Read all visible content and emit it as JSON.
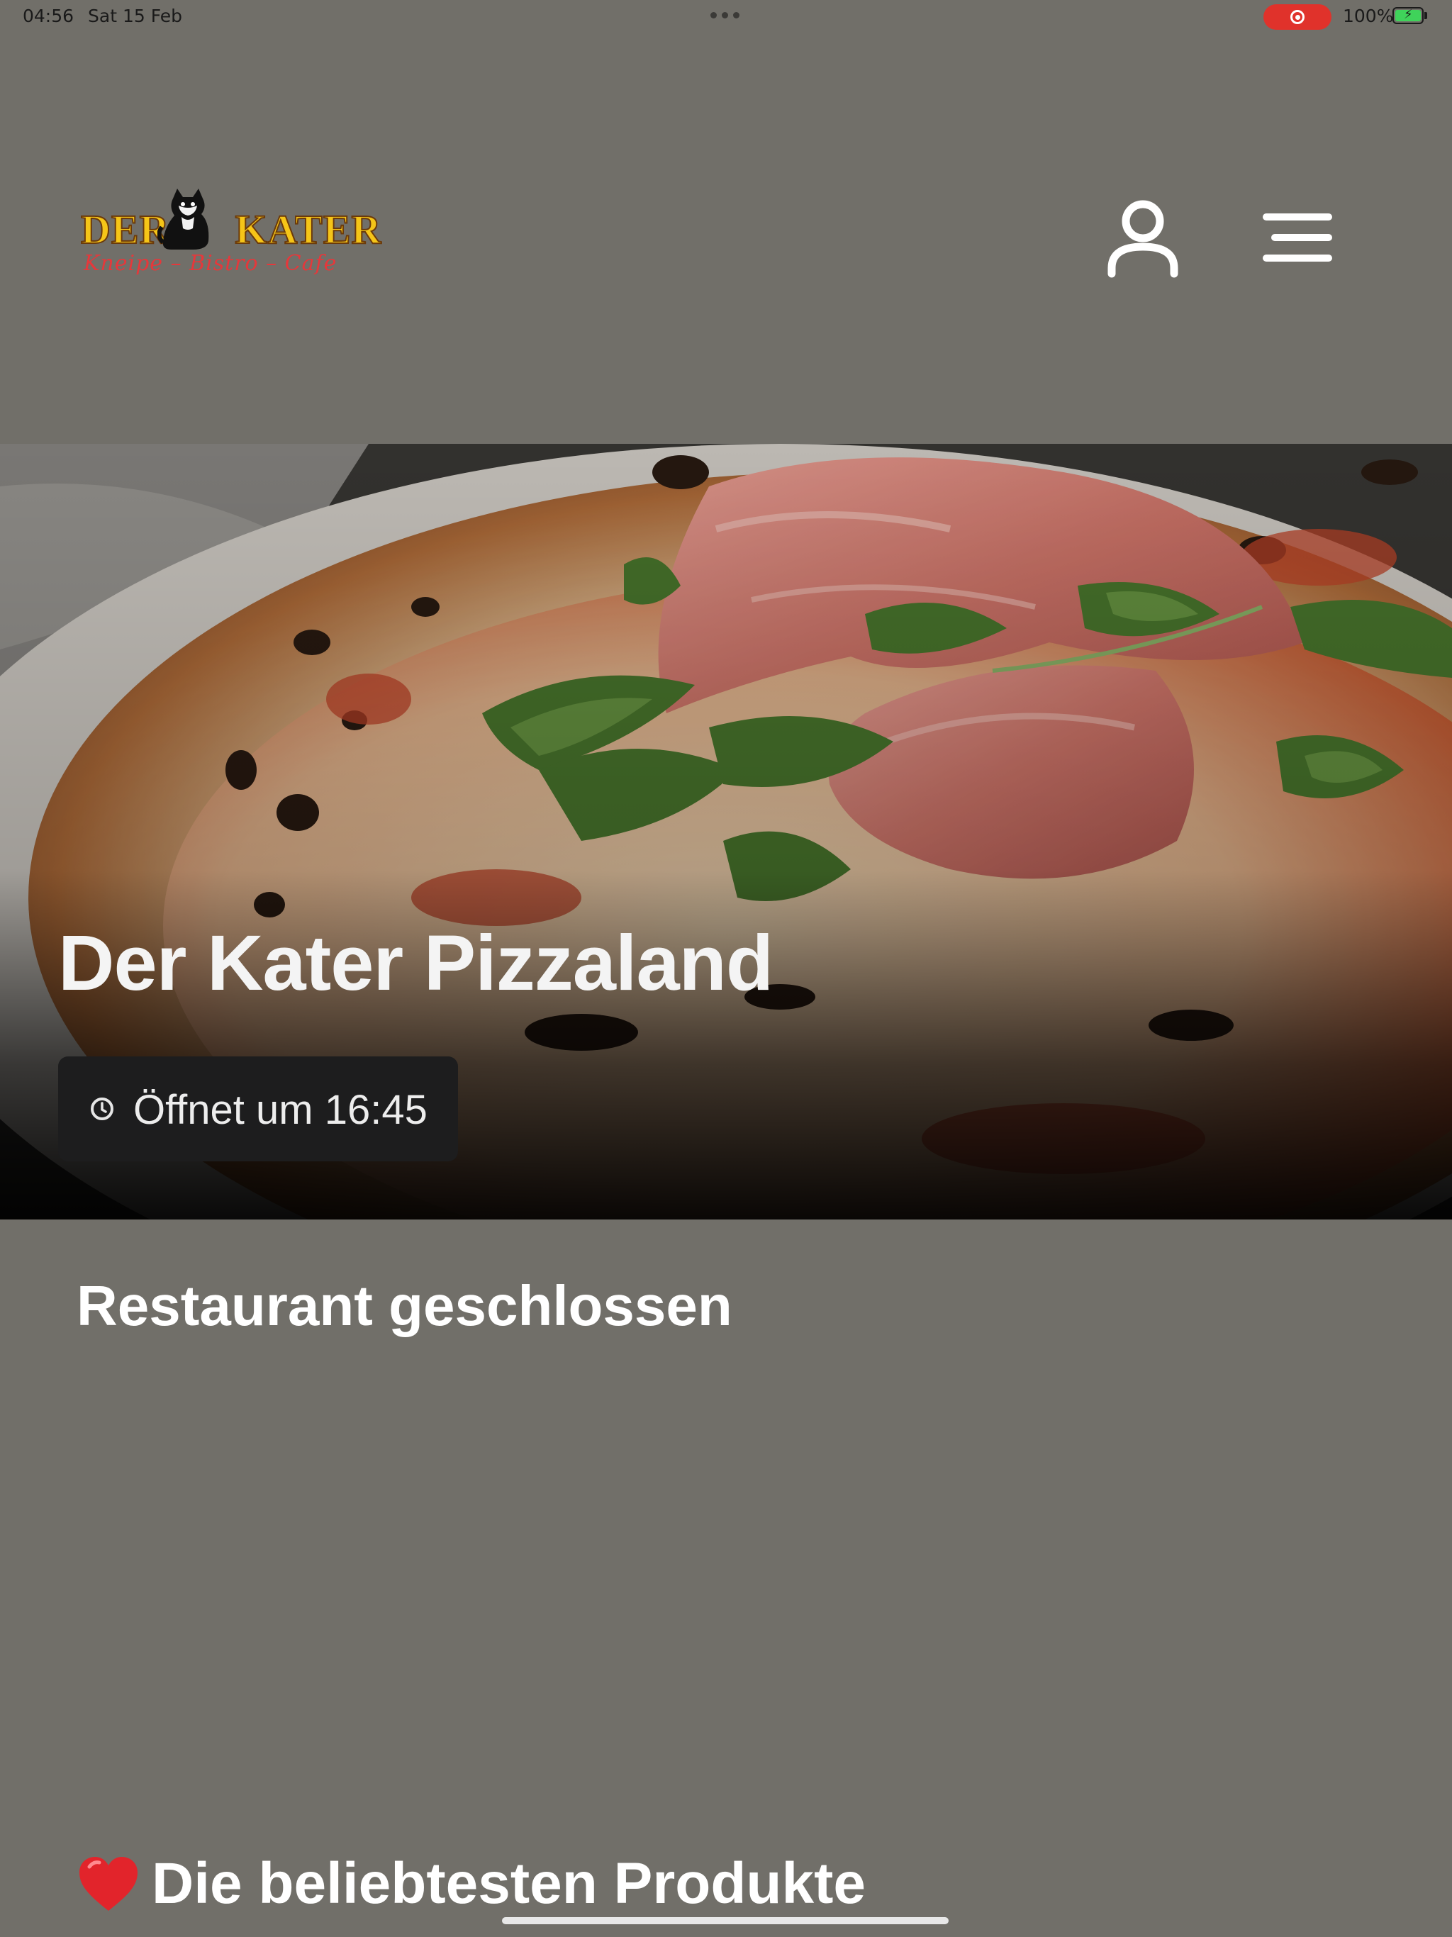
{
  "status_bar": {
    "time": "04:56",
    "date": "Sat 15 Feb",
    "battery_percent": "100%"
  },
  "header": {
    "logo_name_left": "DER",
    "logo_name_right": "KATER",
    "logo_tagline": "Kneipe – Bistro – Cafe",
    "user_icon": "user-icon",
    "menu_icon": "hamburger-menu-icon"
  },
  "hero": {
    "image": "pizza-prosciutto-arugula-photo",
    "title": "Der Kater Pizzaland",
    "hours_icon": "clock-icon",
    "hours_text": "Öffnet um 16:45"
  },
  "main": {
    "status_heading": "Restaurant geschlossen",
    "popular_icon": "heart-icon",
    "popular_heading": "Die beliebtesten Produkte"
  },
  "colors": {
    "background": "#716f69",
    "badge_background": "#1d1d1e",
    "logo_yellow": "#f5c518",
    "logo_red": "#e5383b",
    "recording_red": "#e0322b"
  }
}
